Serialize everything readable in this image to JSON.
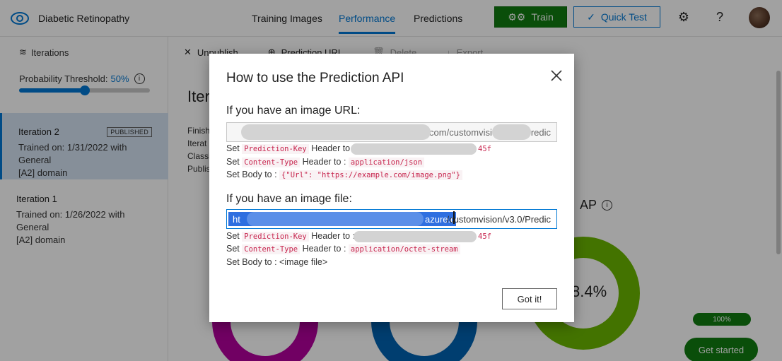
{
  "app": {
    "name": "Diabetic Retinopathy"
  },
  "nav": {
    "training": "Training Images",
    "performance": "Performance",
    "predictions": "Predictions"
  },
  "top_actions": {
    "train": "Train",
    "quick_test": "Quick Test",
    "help": "?"
  },
  "sidebar": {
    "iterations_label": "Iterations",
    "threshold_label": "Probability Threshold:",
    "threshold_value": "50%",
    "threshold_fraction": 0.5,
    "iterations": [
      {
        "title": "Iteration 2",
        "badge": "PUBLISHED",
        "trained": "Trained on: 1/31/2022 with General",
        "domain": "[A2] domain"
      },
      {
        "title": "Iteration 1",
        "badge": "",
        "trained": "Trained on: 1/26/2022 with General",
        "domain": "[A2] domain"
      }
    ]
  },
  "toolbar": {
    "unpublish": "Unpublish",
    "prediction_url": "Prediction URL",
    "delete": "Delete",
    "export": "Export"
  },
  "main": {
    "title_partial": "Iter",
    "meta": [
      "Finish",
      "Iterat",
      "Classi",
      "Publis"
    ],
    "map_partial": "AP",
    "percent_partial": "8.4%",
    "progress": "100%",
    "get_started": "Get started"
  },
  "modal": {
    "title": "How to use the Prediction API",
    "url_section": {
      "heading": "If you have an image URL:",
      "url_visible": ".cognitiveservices.azure.com/customvision/v3.0/Predic",
      "lines": [
        {
          "prefix": "Set ",
          "key": "Prediction-Key",
          "mid": " Header to : ",
          "value": "",
          "tail": "45f"
        },
        {
          "prefix": "Set ",
          "key": "Content-Type",
          "mid": " Header to : ",
          "value": "application/json",
          "tail": ""
        },
        {
          "prefix": "Set Body to : ",
          "key": "",
          "mid": "",
          "value": "{\"Url\": \"https://example.com/image.png\"}",
          "tail": ""
        }
      ]
    },
    "file_section": {
      "heading": "If you have an image file:",
      "url_selected_start": "ht",
      "url_selected_end": "azure.com",
      "url_rest": "/customvision/v3.0/Predic",
      "lines": [
        {
          "prefix": "Set ",
          "key": "Prediction-Key",
          "mid": " Header to : ",
          "value": "",
          "tail": "45f"
        },
        {
          "prefix": "Set ",
          "key": "Content-Type",
          "mid": " Header to : ",
          "value": "application/octet-stream",
          "tail": ""
        },
        {
          "prefix": "Set Body to : <image file>",
          "key": "",
          "mid": "",
          "value": "",
          "tail": ""
        }
      ]
    },
    "got_it": "Got it!"
  },
  "colors": {
    "accent": "#0078d4",
    "train_green": "#107c10",
    "selected_item": "#d4e3f3"
  }
}
